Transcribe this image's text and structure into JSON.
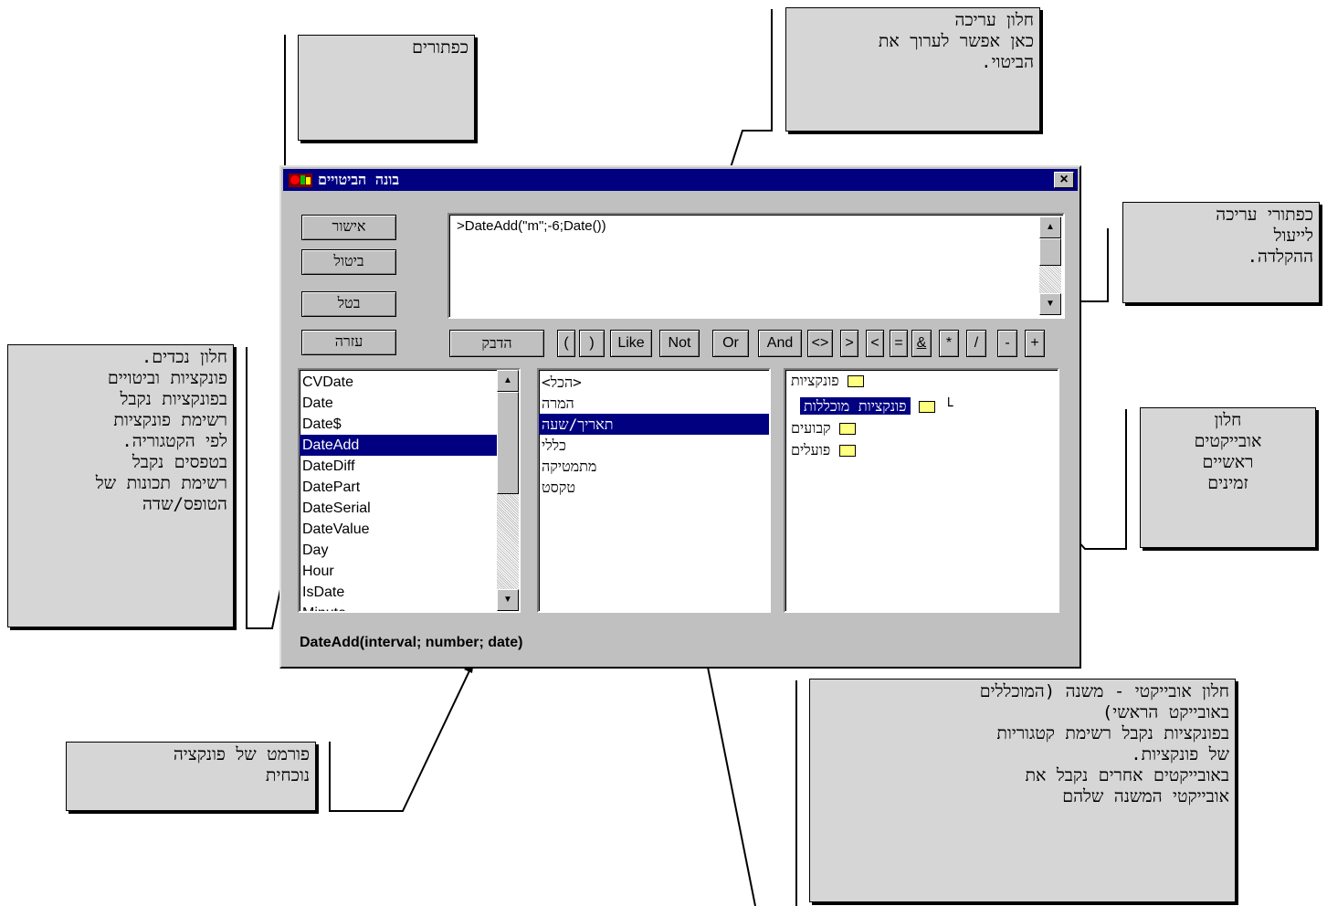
{
  "dialog": {
    "title": "בונה הביטויים",
    "expression": ">DateAdd(\"m\";-6;Date())",
    "buttons": {
      "ok": "אישור",
      "cancel": "ביטול",
      "undo": "בטל",
      "help": "עזרה",
      "paste": "הדבק"
    },
    "operators": [
      "(",
      ")",
      "Like",
      "Not",
      "Or",
      "And",
      "<>",
      ">",
      "<",
      "=",
      "&",
      "*",
      "/",
      "-",
      "+"
    ],
    "functions_list": [
      "CVDate",
      "Date",
      "Date$",
      "DateAdd",
      "DateDiff",
      "DatePart",
      "DateSerial",
      "DateValue",
      "Day",
      "Hour",
      "IsDate",
      "Minute"
    ],
    "functions_selected": "DateAdd",
    "categories_list": [
      "<הכל>",
      "המרה",
      "תאריך/שעה",
      "כללי",
      "מתמטיקה",
      "טקסט"
    ],
    "categories_selected": "תאריך/שעה",
    "tree": {
      "functions": "פונקציות",
      "builtin": "פונקציות מוכללות",
      "constants": "קבועים",
      "operators": "פועלים"
    },
    "syntax": "DateAdd(interval; number; date)"
  },
  "callouts": {
    "buttons": "כפתורים",
    "edit_window": "חלון עריכה\nכאן אפשר לערוך את\nהביטוי.",
    "edit_buttons": "כפתורי עריכה\nלייעול\nההקלדה.",
    "elements_window": "חלון נכדים.\nפונקציות וביטויים\nבפונקציות נקבל\nרשימת פונקציות\nלפי הקטגוריה.\nבטפסים נקבל\nרשימת תכונות של\nהטופס/שדה",
    "main_objects": "חלון\nאובייקטים\nראשיים\nזמינים",
    "sub_objects": "חלון אובייקטי - משנה (המוכללים\nבאובייקט הראשי)\nבפונקציות נקבל רשימת קטגוריות\nשל פונקציות.\nבאובייקטים אחרים נקבל את\nאובייקטי המשנה שלהם",
    "function_format": "פורמט של פונקציה\nנוכחית"
  }
}
